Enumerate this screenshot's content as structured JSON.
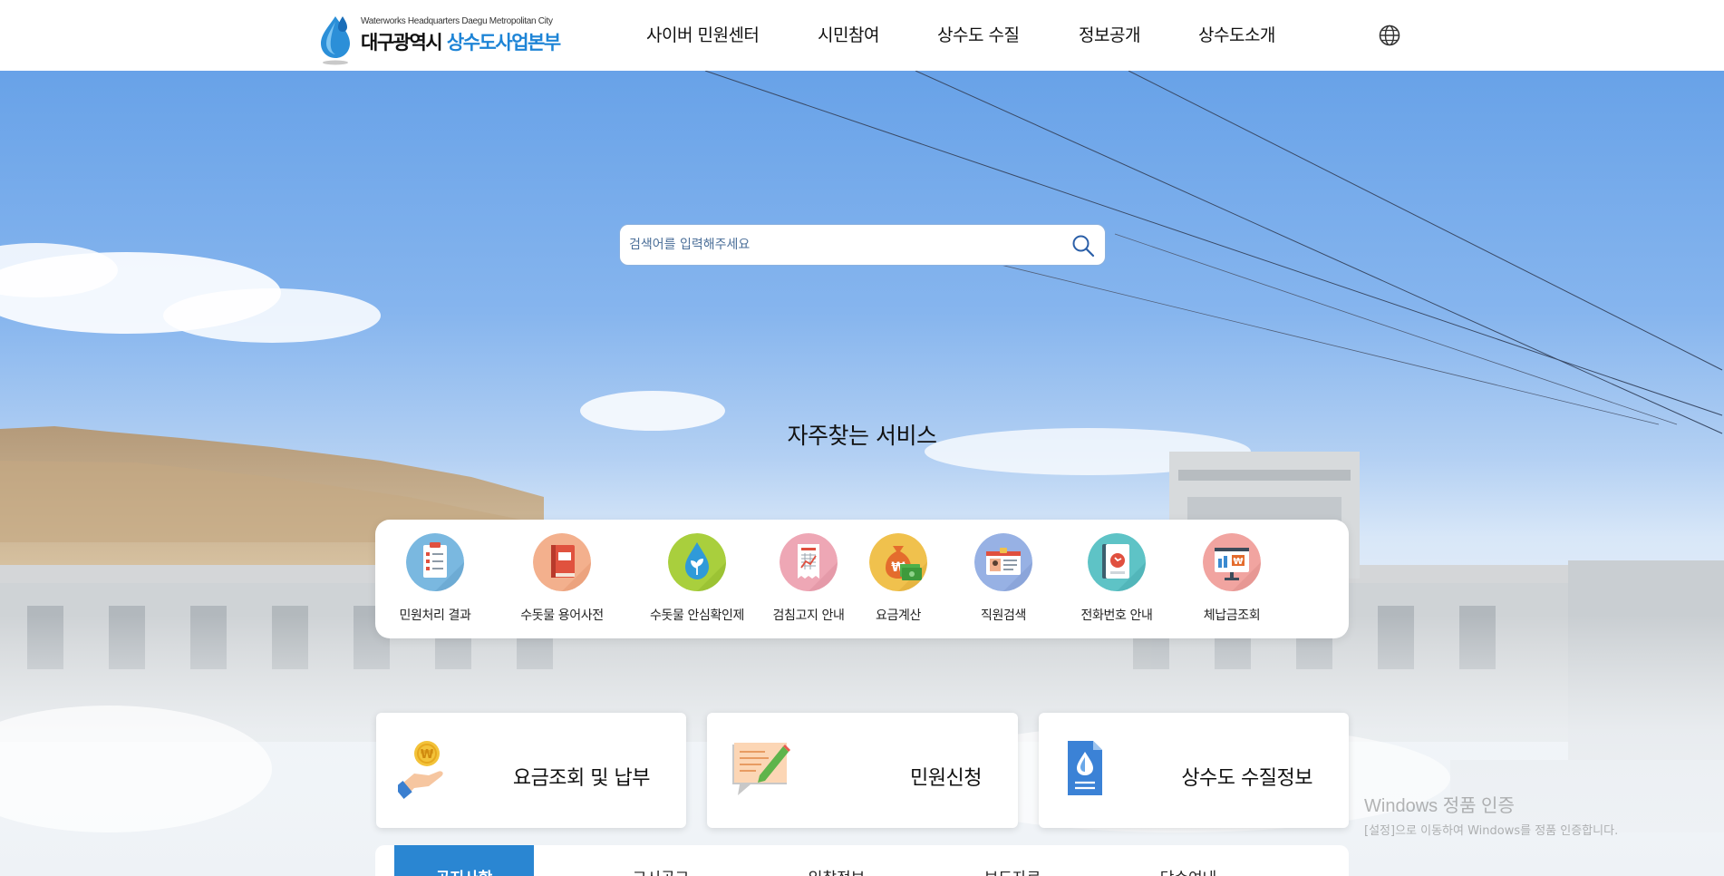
{
  "header": {
    "logo_en": "Waterworks Headquarters Daegu Metropolitan City",
    "logo_ko_main": "대구광역시 ",
    "logo_ko_accent": "상수도사업본부",
    "nav": [
      {
        "label": "사이버 민원센터"
      },
      {
        "label": "시민참여"
      },
      {
        "label": "상수도 수질"
      },
      {
        "label": "정보공개"
      },
      {
        "label": "상수도소개"
      }
    ],
    "globe_icon": "globe-icon"
  },
  "search": {
    "placeholder": "검색어를 입력해주세요",
    "value": "",
    "icon": "search-icon"
  },
  "services": {
    "title": "자주찾는 서비스",
    "items": [
      {
        "label": "민원처리 결과",
        "icon": "clipboard-checklist-icon",
        "color": "#7ab8e0"
      },
      {
        "label": "수돗물 용어사전",
        "icon": "book-icon",
        "color": "#f3b08d"
      },
      {
        "label": "수돗물 안심확인제",
        "icon": "water-drop-leaf-icon",
        "color": "#a9cf3d"
      },
      {
        "label": "검침고지 안내",
        "icon": "receipt-icon",
        "color": "#eea7b5"
      },
      {
        "label": "요금계산",
        "icon": "money-bag-icon",
        "color": "#f0c14d"
      },
      {
        "label": "직원검색",
        "icon": "id-card-icon",
        "color": "#97b1e4"
      },
      {
        "label": "전화번호 안내",
        "icon": "phone-book-icon",
        "color": "#5ec3c6"
      },
      {
        "label": "체납금조회",
        "icon": "monitor-won-icon",
        "color": "#f1a4a0"
      }
    ]
  },
  "cards": [
    {
      "label": "요금조회 및 납부",
      "icon": "coin-hand-icon"
    },
    {
      "label": "민원신청",
      "icon": "memo-pencil-icon"
    },
    {
      "label": "상수도 수질정보",
      "icon": "water-document-icon"
    }
  ],
  "tabs": [
    {
      "label": "공지사항",
      "active": true
    },
    {
      "label": "고시공고",
      "active": false
    },
    {
      "label": "입찰정보",
      "active": false
    },
    {
      "label": "보도자료",
      "active": false
    },
    {
      "label": "당수여내",
      "active": false
    }
  ],
  "watermark": {
    "line1": "Windows 정품 인증",
    "line2": "[설정]으로 이동하여 Windows를 정품 인증합니다."
  },
  "colors": {
    "accent": "#2a86d2",
    "logo_accent": "#1d84d6"
  }
}
